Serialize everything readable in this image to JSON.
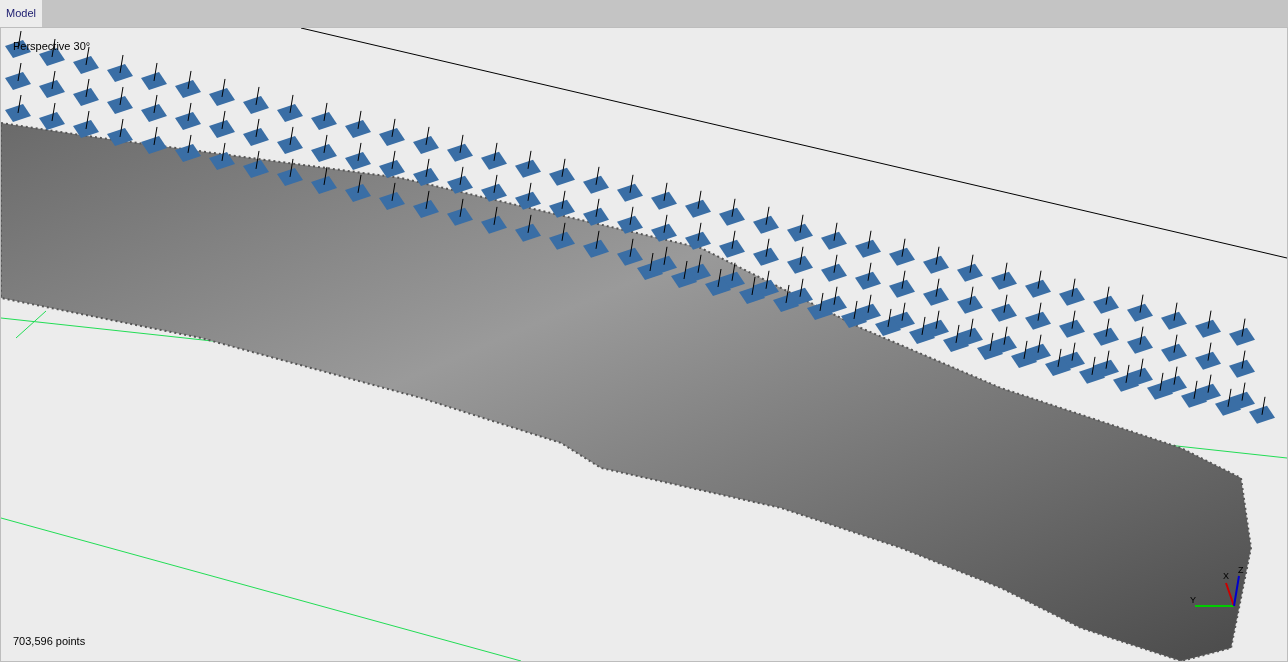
{
  "tabs": [
    {
      "label": "Model",
      "selected": true
    }
  ],
  "viewport": {
    "projection": "Perspective 30°",
    "point_count": "703,596 points",
    "axes": {
      "x": "X",
      "y": "Y",
      "z": "Z"
    }
  }
}
